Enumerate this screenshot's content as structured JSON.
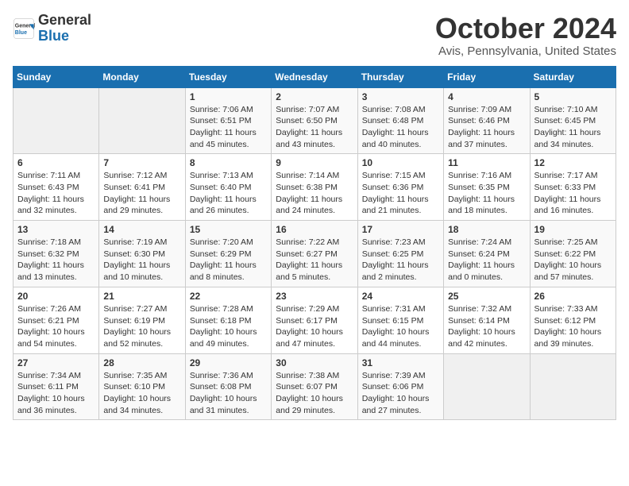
{
  "header": {
    "logo_line1": "General",
    "logo_line2": "Blue",
    "month": "October 2024",
    "location": "Avis, Pennsylvania, United States"
  },
  "weekdays": [
    "Sunday",
    "Monday",
    "Tuesday",
    "Wednesday",
    "Thursday",
    "Friday",
    "Saturday"
  ],
  "weeks": [
    [
      {
        "day": "",
        "detail": ""
      },
      {
        "day": "",
        "detail": ""
      },
      {
        "day": "1",
        "detail": "Sunrise: 7:06 AM\nSunset: 6:51 PM\nDaylight: 11 hours and 45 minutes."
      },
      {
        "day": "2",
        "detail": "Sunrise: 7:07 AM\nSunset: 6:50 PM\nDaylight: 11 hours and 43 minutes."
      },
      {
        "day": "3",
        "detail": "Sunrise: 7:08 AM\nSunset: 6:48 PM\nDaylight: 11 hours and 40 minutes."
      },
      {
        "day": "4",
        "detail": "Sunrise: 7:09 AM\nSunset: 6:46 PM\nDaylight: 11 hours and 37 minutes."
      },
      {
        "day": "5",
        "detail": "Sunrise: 7:10 AM\nSunset: 6:45 PM\nDaylight: 11 hours and 34 minutes."
      }
    ],
    [
      {
        "day": "6",
        "detail": "Sunrise: 7:11 AM\nSunset: 6:43 PM\nDaylight: 11 hours and 32 minutes."
      },
      {
        "day": "7",
        "detail": "Sunrise: 7:12 AM\nSunset: 6:41 PM\nDaylight: 11 hours and 29 minutes."
      },
      {
        "day": "8",
        "detail": "Sunrise: 7:13 AM\nSunset: 6:40 PM\nDaylight: 11 hours and 26 minutes."
      },
      {
        "day": "9",
        "detail": "Sunrise: 7:14 AM\nSunset: 6:38 PM\nDaylight: 11 hours and 24 minutes."
      },
      {
        "day": "10",
        "detail": "Sunrise: 7:15 AM\nSunset: 6:36 PM\nDaylight: 11 hours and 21 minutes."
      },
      {
        "day": "11",
        "detail": "Sunrise: 7:16 AM\nSunset: 6:35 PM\nDaylight: 11 hours and 18 minutes."
      },
      {
        "day": "12",
        "detail": "Sunrise: 7:17 AM\nSunset: 6:33 PM\nDaylight: 11 hours and 16 minutes."
      }
    ],
    [
      {
        "day": "13",
        "detail": "Sunrise: 7:18 AM\nSunset: 6:32 PM\nDaylight: 11 hours and 13 minutes."
      },
      {
        "day": "14",
        "detail": "Sunrise: 7:19 AM\nSunset: 6:30 PM\nDaylight: 11 hours and 10 minutes."
      },
      {
        "day": "15",
        "detail": "Sunrise: 7:20 AM\nSunset: 6:29 PM\nDaylight: 11 hours and 8 minutes."
      },
      {
        "day": "16",
        "detail": "Sunrise: 7:22 AM\nSunset: 6:27 PM\nDaylight: 11 hours and 5 minutes."
      },
      {
        "day": "17",
        "detail": "Sunrise: 7:23 AM\nSunset: 6:25 PM\nDaylight: 11 hours and 2 minutes."
      },
      {
        "day": "18",
        "detail": "Sunrise: 7:24 AM\nSunset: 6:24 PM\nDaylight: 11 hours and 0 minutes."
      },
      {
        "day": "19",
        "detail": "Sunrise: 7:25 AM\nSunset: 6:22 PM\nDaylight: 10 hours and 57 minutes."
      }
    ],
    [
      {
        "day": "20",
        "detail": "Sunrise: 7:26 AM\nSunset: 6:21 PM\nDaylight: 10 hours and 54 minutes."
      },
      {
        "day": "21",
        "detail": "Sunrise: 7:27 AM\nSunset: 6:19 PM\nDaylight: 10 hours and 52 minutes."
      },
      {
        "day": "22",
        "detail": "Sunrise: 7:28 AM\nSunset: 6:18 PM\nDaylight: 10 hours and 49 minutes."
      },
      {
        "day": "23",
        "detail": "Sunrise: 7:29 AM\nSunset: 6:17 PM\nDaylight: 10 hours and 47 minutes."
      },
      {
        "day": "24",
        "detail": "Sunrise: 7:31 AM\nSunset: 6:15 PM\nDaylight: 10 hours and 44 minutes."
      },
      {
        "day": "25",
        "detail": "Sunrise: 7:32 AM\nSunset: 6:14 PM\nDaylight: 10 hours and 42 minutes."
      },
      {
        "day": "26",
        "detail": "Sunrise: 7:33 AM\nSunset: 6:12 PM\nDaylight: 10 hours and 39 minutes."
      }
    ],
    [
      {
        "day": "27",
        "detail": "Sunrise: 7:34 AM\nSunset: 6:11 PM\nDaylight: 10 hours and 36 minutes."
      },
      {
        "day": "28",
        "detail": "Sunrise: 7:35 AM\nSunset: 6:10 PM\nDaylight: 10 hours and 34 minutes."
      },
      {
        "day": "29",
        "detail": "Sunrise: 7:36 AM\nSunset: 6:08 PM\nDaylight: 10 hours and 31 minutes."
      },
      {
        "day": "30",
        "detail": "Sunrise: 7:38 AM\nSunset: 6:07 PM\nDaylight: 10 hours and 29 minutes."
      },
      {
        "day": "31",
        "detail": "Sunrise: 7:39 AM\nSunset: 6:06 PM\nDaylight: 10 hours and 27 minutes."
      },
      {
        "day": "",
        "detail": ""
      },
      {
        "day": "",
        "detail": ""
      }
    ]
  ]
}
